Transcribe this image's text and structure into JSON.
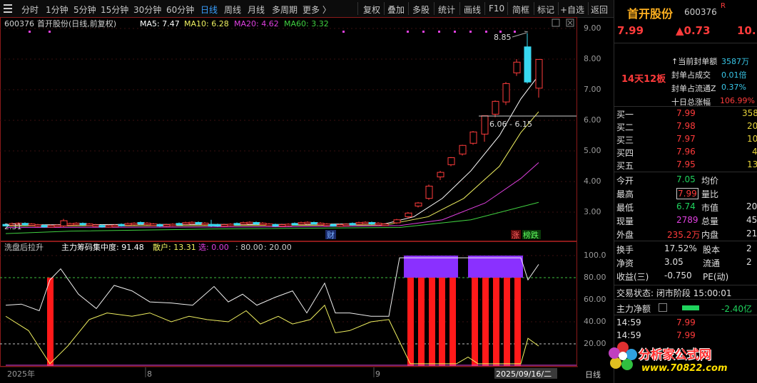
{
  "toolbar": {
    "periods": [
      "分时",
      "1分钟",
      "5分钟",
      "15分钟",
      "30分钟",
      "60分钟",
      "日线",
      "周线",
      "月线",
      "多周期",
      "更多 〉"
    ],
    "active_period": "日线",
    "tools": [
      "复权",
      "叠加",
      "多股",
      "统计",
      "画线",
      "F10",
      "简框",
      "标记",
      "+自选",
      "返回"
    ]
  },
  "main_chart": {
    "code": "600376",
    "title": "首开股份(日线,前复权)",
    "ma5": "MA5: 7.47",
    "ma10": "MA10: 6.28",
    "ma20": "MA20: 4.62",
    "ma60": "MA60: 3.32",
    "high_label": "8.85",
    "range_label": "6.06 - 6.15",
    "low_label": "2.31",
    "marker_cai": "财",
    "marker_zhang": "涨",
    "marker_bang": "榜跌",
    "yticks": [
      "9.00",
      "8.00",
      "7.00",
      "6.00",
      "5.00",
      "4.00",
      "3.00"
    ],
    "colors": {
      "up": "#ff3b3b",
      "down": "#38d8f0",
      "ma5": "#ffffff",
      "ma10": "#f0f060",
      "ma20": "#e040e0",
      "ma60": "#40d040"
    }
  },
  "indicator": {
    "name": "洗盘后拉升",
    "title_text": "主力筹码集中度: 91.48",
    "sanhu": "散户: 13.31",
    "xuan": "选: 0.00",
    "l80": ": 80.00",
    "l20": ": 20.00",
    "yticks": [
      "100.0",
      "80.00",
      "60.00",
      "40.00",
      "20.00"
    ]
  },
  "xaxis": {
    "labels": [
      "2025年",
      "8",
      "9"
    ],
    "cursor_date": "2025/09/16/二",
    "period": "日线"
  },
  "quote": {
    "name": "首开股份",
    "code": "600376",
    "r_badge": "R",
    "price": "7.99",
    "change": "▲0.73",
    "pct": "10.",
    "streak": "14天12板",
    "seal_rows": [
      {
        "label": "↑当前封单额",
        "value": "3587万"
      },
      {
        "label": "封单占成交",
        "value": "0.01倍"
      },
      {
        "label": "封单占流通Z",
        "value": "0.37%"
      },
      {
        "label": "十日总涨幅",
        "value": "106.99%"
      }
    ],
    "orders": [
      {
        "label": "买一",
        "price": "7.99",
        "vol": "358"
      },
      {
        "label": "买二",
        "price": "7.98",
        "vol": "20"
      },
      {
        "label": "买三",
        "price": "7.97",
        "vol": "10"
      },
      {
        "label": "买四",
        "price": "7.96",
        "vol": "4"
      },
      {
        "label": "买五",
        "price": "7.95",
        "vol": "13"
      }
    ],
    "stats": [
      {
        "l1": "今开",
        "v1": "7.05",
        "l2": "均价",
        "v2": ""
      },
      {
        "l1": "最高",
        "v1": "7.99",
        "l2": "量比",
        "v2": ""
      },
      {
        "l1": "最低",
        "v1": "6.74",
        "l2": "市值",
        "v2": "20"
      },
      {
        "l1": "现量",
        "v1": "2789",
        "l2": "总量",
        "v2": "45"
      },
      {
        "l1": "外盘",
        "v1": "235.2万",
        "l2": "内盘",
        "v2": "21"
      }
    ],
    "fund": [
      {
        "l1": "换手",
        "v1": "17.52%",
        "l2": "股本",
        "v2": "2"
      },
      {
        "l1": "净资",
        "v1": "3.05",
        "l2": "流通",
        "v2": "2"
      },
      {
        "l1": "收益(三)",
        "v1": "-0.750",
        "l2": "PE(动)",
        "v2": ""
      }
    ],
    "trade_status": "交易状态: 闭市阶段 15:00:01",
    "main_net_label": "主力净额",
    "main_net_value": "-2.40亿",
    "ticks": [
      {
        "time": "14:59",
        "price": "7.99"
      },
      {
        "time": "14:59",
        "price": "7.99"
      }
    ]
  },
  "watermark": {
    "text": "分析家公式网",
    "url": "www.70822.com"
  }
}
